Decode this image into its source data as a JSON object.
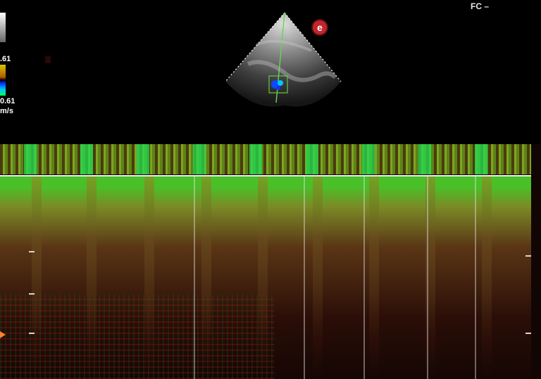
{
  "status": {
    "fc": "FC –"
  },
  "scale": {
    "top_value": ".61",
    "bottom_value": "0.61",
    "unit": "m/s"
  },
  "logo": {
    "glyph": "e"
  },
  "icons": [
    "echo-sector-icon",
    "logo-icon",
    "doppler-strip-icon",
    "orange-indicator-icon"
  ],
  "colors": {
    "echo_bright": "#f1f1f1",
    "doppler_green": "#39f07a",
    "doppler_brown": "#7a3a14",
    "logo_red": "#c1262c"
  }
}
